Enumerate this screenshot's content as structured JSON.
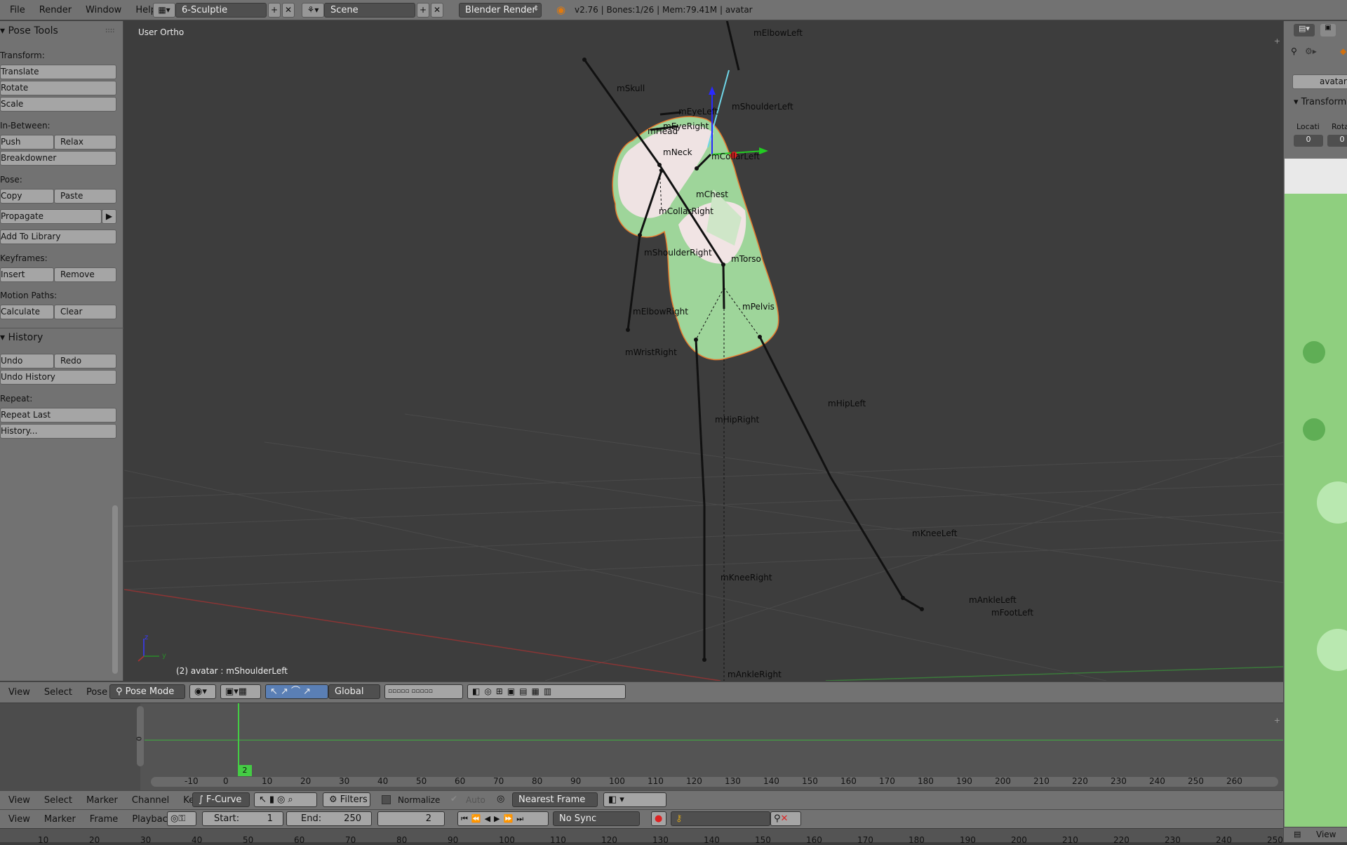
{
  "topbar": {
    "menus": [
      "File",
      "Render",
      "Window",
      "Help"
    ],
    "screen_layout": "6-Sculptie",
    "scene": "Scene",
    "engine": "Blender Render",
    "info": "v2.76 | Bones:1/26 | Mem:79.41M | avatar"
  },
  "tool_panel": {
    "title": "Pose Tools",
    "transform_label": "Transform:",
    "translate": "Translate",
    "rotate": "Rotate",
    "scale": "Scale",
    "inbetween_label": "In-Between:",
    "push": "Push",
    "relax": "Relax",
    "breakdowner": "Breakdowner",
    "pose_label": "Pose:",
    "copy": "Copy",
    "paste": "Paste",
    "propagate": "Propagate",
    "add_to_library": "Add To Library",
    "keyframes_label": "Keyframes:",
    "insert": "Insert",
    "remove": "Remove",
    "motion_paths_label": "Motion Paths:",
    "calculate": "Calculate",
    "clear": "Clear",
    "history_title": "History",
    "undo": "Undo",
    "redo": "Redo",
    "undo_history": "Undo History",
    "repeat_label": "Repeat:",
    "repeat_last": "Repeat Last",
    "history_more": "History..."
  },
  "viewport": {
    "view_name": "User Ortho",
    "status": "(2) avatar : mShoulderLeft",
    "bones": [
      "mElbowLeft",
      "mSkull",
      "mEyeLeft",
      "mShoulderLeft",
      "mEyeRight",
      "mHead",
      "mNeck",
      "mCollarLeft",
      "mChest",
      "mCollarRight",
      "mShoulderRight",
      "mTorso",
      "mPelvis",
      "mElbowRight",
      "mWristRight",
      "mHipLeft",
      "mHipRight",
      "mKneeLeft",
      "mAnkleLeft",
      "mFootLeft",
      "mKneeRight",
      "mAnkleRight"
    ],
    "axis_z": "z",
    "axis_y": "y"
  },
  "view3d_header": {
    "menus": [
      "View",
      "Select",
      "Pose"
    ],
    "mode": "Pose Mode",
    "orientation": "Global"
  },
  "graph": {
    "y_zero": "0",
    "current_frame_badge": "2",
    "ticks": [
      "-10",
      "0",
      "10",
      "20",
      "30",
      "40",
      "50",
      "60",
      "70",
      "80",
      "90",
      "100",
      "110",
      "120",
      "130",
      "140",
      "150",
      "160",
      "170",
      "180",
      "190",
      "200",
      "210",
      "220",
      "230",
      "240",
      "250",
      "260"
    ]
  },
  "graph_header": {
    "menus": [
      "View",
      "Select",
      "Marker",
      "Channel",
      "Key"
    ],
    "mode": "F-Curve",
    "filters": "Filters",
    "normalize": "Normalize",
    "auto": "Auto",
    "snap": "Nearest Frame"
  },
  "timeline_header": {
    "menus": [
      "View",
      "Marker",
      "Frame",
      "Playback"
    ],
    "start_label": "Start:",
    "start_value": "1",
    "end_label": "End:",
    "end_value": "250",
    "current_frame": "2",
    "sync": "No Sync"
  },
  "timeline_ruler": [
    "10",
    "20",
    "30",
    "40",
    "50",
    "60",
    "70",
    "80",
    "90",
    "100",
    "110",
    "120",
    "130",
    "140",
    "150",
    "160",
    "170",
    "180",
    "190",
    "200",
    "210",
    "220",
    "230",
    "240",
    "250"
  ],
  "properties": {
    "object": "avatar",
    "transform_title": "Transform",
    "location": "Locati",
    "rotation": "Rota",
    "zero": "0",
    "view": "View"
  },
  "colors": {
    "panel": "#727272",
    "viewport_bg": "#3d3d3d",
    "selected_bone": "#6fd6e8",
    "frame_line": "#44cc44",
    "avatar_green": "#8fd08a"
  }
}
